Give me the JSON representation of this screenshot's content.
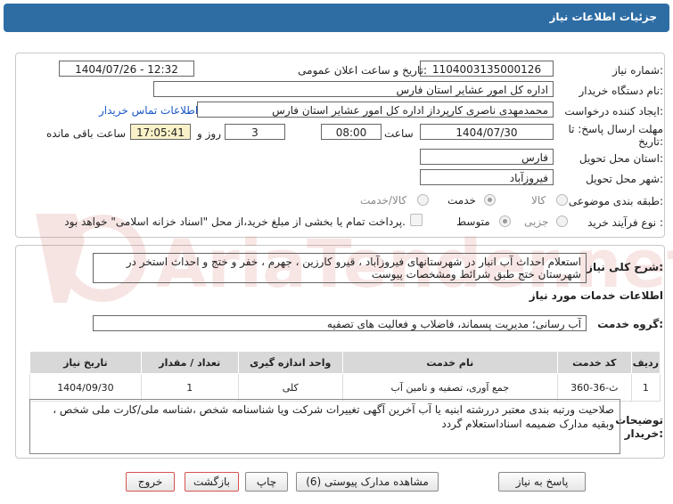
{
  "header": {
    "title": "جزئیات اطلاعات نیاز"
  },
  "fields": {
    "need_number_label": "شماره نیاز:",
    "need_number": "1104003135000126",
    "announce_label": "تاریخ و ساعت اعلان عمومی:",
    "announce_value": "1404/07/26 - 12:32",
    "buyer_org_label": "نام دستگاه خریدار:",
    "buyer_org": "اداره کل امور عشایر استان فارس",
    "creator_label": "ایجاد کننده درخواست:",
    "creator": "محمدمهدی ناصری کارپرداز اداره کل امور عشایر استان فارس",
    "contact_link": "اطلاعات تماس خریدار",
    "deadline_label_1": "مهلت ارسال پاسخ: تا",
    "deadline_label_2": "تاریخ:",
    "deadline_date": "1404/07/30",
    "time_label": "ساعت",
    "deadline_time": "08:00",
    "days_value": "3",
    "days_label": "روز و",
    "remaining_value": "17:05:41",
    "remaining_label": "ساعت باقی مانده",
    "province_label": "استان محل تحویل:",
    "province": "فارس",
    "city_label": "شهر محل تحویل:",
    "city": "فیروزآباد",
    "category_label": "طبقه بندی موضوعی:",
    "category_options": [
      "کالا",
      "خدمت",
      "کالا/خدمت"
    ],
    "process_label": "نوع فرآیند خرید :",
    "process_options": [
      "جزیی",
      "متوسط"
    ],
    "payment_note": "پرداخت تمام یا بخشی از مبلغ خرید،از محل \"اسناد خزانه اسلامی\" خواهد بود."
  },
  "description": {
    "label": "شرح کلی نیاز:",
    "text": "استعلام احداث آب انبار  در شهرستانهای  فیروزآباد ، قیرو کارزین ، جهرم ، خفر و ختج و احداث استخر در شهرستان ختج طبق شرائط ومشخصات پیوست"
  },
  "services": {
    "section_title": "اطلاعات خدمات مورد نیاز",
    "group_label": "گروه خدمت:",
    "group_value": "آب رسانی؛ مدیریت پسماند، فاضلاب و فعالیت های تصفیه",
    "columns": [
      "ردیف",
      "کد خدمت",
      "نام خدمت",
      "واحد اندازه گیری",
      "تعداد / مقدار",
      "تاریخ نیاز"
    ],
    "rows": [
      {
        "row": "1",
        "code": "ث-36-360",
        "name": "جمع آوری، تصفیه و تامین آب",
        "unit": "کلی",
        "qty": "1",
        "date": "1404/09/30"
      }
    ]
  },
  "buyer_notes": {
    "label_1": "توضیحات",
    "label_2": "خریدار:",
    "text": "صلاحیت ورتبه بندی معتبر دررشته  ابنیه یا آب  آخرین آگهی تغییرات شرکت ویا شناسنامه شخص ،شناسه ملی/کارت ملی شخص ، وبقیه مدارک  ضمیمه اسناداستعلام گردد"
  },
  "buttons": {
    "reply": "پاسخ به نیاز",
    "attachments": "مشاهده مدارک پیوستی (6)",
    "print": "چاپ",
    "back": "بازگشت",
    "exit": "خروج"
  },
  "watermark": {
    "text": "AriaTender.net"
  },
  "colors": {
    "header_bg": "#2e6da4",
    "link": "#1a56c8",
    "highlight": "#f9f2c8",
    "exit_border": "#d9534f"
  }
}
